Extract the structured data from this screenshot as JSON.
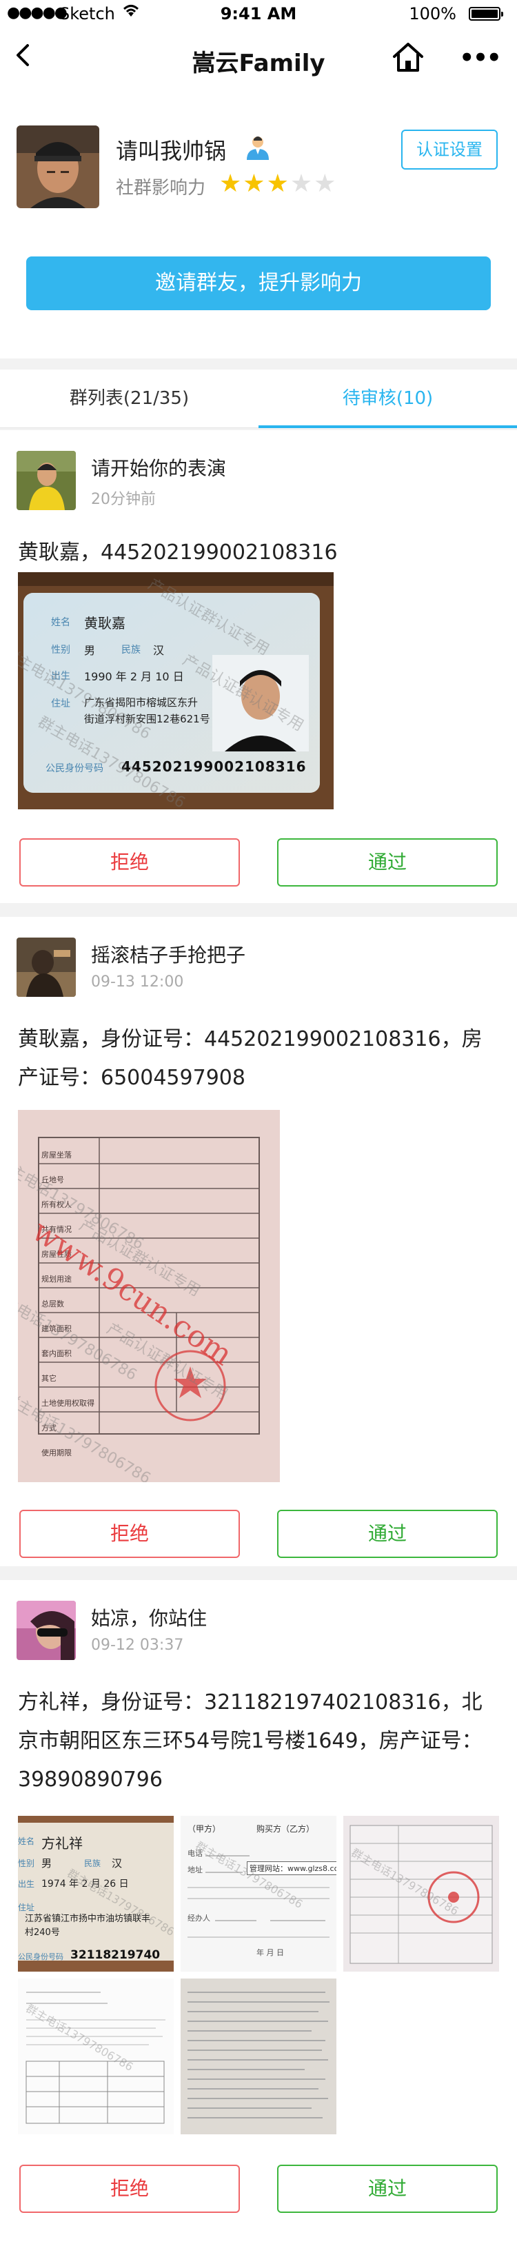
{
  "status_bar": {
    "signal": "●●●●●",
    "carrier": "Sketch",
    "time": "9:41 AM",
    "battery": "100%"
  },
  "nav": {
    "title": "嵩云Family",
    "more": "•••"
  },
  "profile": {
    "name": "请叫我帅锅",
    "influence_label": "社群影响力",
    "rating": 3,
    "rating_max": 5,
    "cert_button": "认证设置"
  },
  "invite_button": "邀请群友，提升影响力",
  "tabs": [
    {
      "label": "群列表(21/35)",
      "active": false
    },
    {
      "label": "待审核(10)",
      "active": true
    }
  ],
  "requests": [
    {
      "user": "请开始你的表演",
      "time": "20分钟前",
      "description": "黄耿嘉，445202199002108316",
      "reject": "拒绝",
      "approve": "通过",
      "id_card": {
        "name_label": "姓名",
        "name": "黄耿嘉",
        "gender_label": "性别",
        "gender": "男",
        "ethnicity_label": "民族",
        "ethnicity": "汉",
        "birth_label": "出生",
        "birth": "1990 年 2 月 10 日",
        "address_label": "住址",
        "address_line1": "广东省揭阳市榕城区东升",
        "address_line2": "街道浮村新安围12巷621号",
        "id_label": "公民身份号码",
        "id_number": "445202199002108316"
      },
      "watermarks": [
        "群主电话13797806786",
        "产品认证群认证专用"
      ]
    },
    {
      "user": "摇滚桔子手抢把子",
      "time": "09-13 12:00",
      "description": "黄耿嘉，身份证号：445202199002108316，房产证号：65004597908",
      "reject": "拒绝",
      "approve": "通过",
      "property_doc": {
        "labels": [
          "房屋坐落",
          "丘地号",
          "所有权人",
          "共有情况",
          "房屋性质",
          "规划用途",
          "总层数",
          "建筑面积",
          "套内面积",
          "其它",
          "土地使用权取得方式",
          "使用期限"
        ],
        "stamp_text": "www.9cun.com"
      },
      "watermarks": [
        "群主电话13797806786",
        "产品认证群认证专用"
      ]
    },
    {
      "user": "姑凉，你站住",
      "time": "09-12 03:37",
      "description": "方礼祥，身份证号：321182197402108316，北京市朝阳区东三环54号院1号楼1649，房产证号：39890890796",
      "reject": "拒绝",
      "approve": "通过",
      "id_card": {
        "name_label": "姓名",
        "name": "方礼祥",
        "gender_label": "性别",
        "gender": "男",
        "ethnicity_label": "民族",
        "ethnicity": "汉",
        "birth_label": "出生",
        "birth": "1974 年 2 月 26 日",
        "address_label": "住址",
        "address_line1": "江苏省镇江市扬中市油坊镇联丰",
        "address_line2": "村240号",
        "id_label": "公民身份号码",
        "id_number": "32118219740"
      },
      "contract": {
        "party_a": "（甲方）",
        "party_b": "购买方（乙方）",
        "website": "管理网站：www.glzs8.com",
        "phone_label": "电话",
        "address_label": "地址",
        "agent_label": "经办人",
        "date_label": "年 月 日"
      },
      "watermarks": [
        "群主电话13797806786",
        "产品认证群认证专用"
      ]
    }
  ],
  "colors": {
    "accent": "#29b5ef",
    "invite_bg": "#33b6ee",
    "reject": "#ea3b3e",
    "approve": "#2faa33",
    "star_on": "#f8c300",
    "star_off": "#e0e0e0"
  }
}
